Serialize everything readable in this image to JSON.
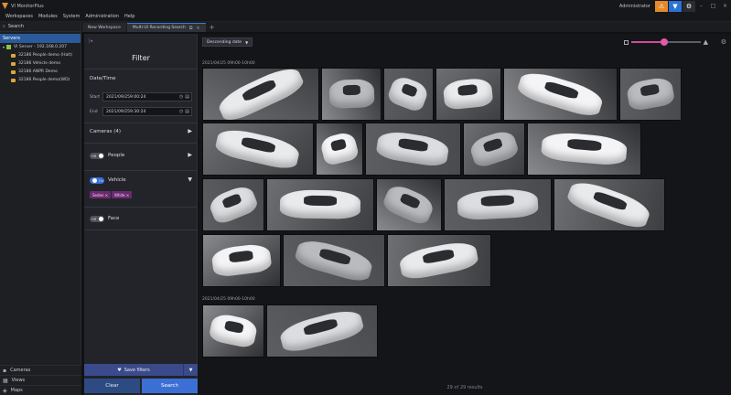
{
  "app": {
    "title": "VI MonitorPlus",
    "user": "Administrator"
  },
  "menu": [
    "Workspaces",
    "Modules",
    "System",
    "Administration",
    "Help"
  ],
  "sidebar": {
    "search_label": "Search",
    "section_label": "Servers",
    "tree": [
      {
        "label": "VI Server - 192.168.0.207",
        "kind": "server"
      },
      {
        "label": "32186 People demo (Halt)",
        "kind": "camera"
      },
      {
        "label": "32186 Vehicle demo",
        "kind": "camera"
      },
      {
        "label": "32186 ANPR Demo",
        "kind": "camera"
      },
      {
        "label": "32186 People demo(WD)",
        "kind": "camera"
      }
    ],
    "bottom": [
      {
        "label": "Cameras",
        "icon": "camera-icon"
      },
      {
        "label": "Views",
        "icon": "grid-icon"
      },
      {
        "label": "Maps",
        "icon": "map-icon"
      }
    ]
  },
  "tabs": [
    {
      "label": "New Workspace",
      "active": false
    },
    {
      "label": "Multi-Ul Recording Search",
      "active": true
    }
  ],
  "filter": {
    "title": "Filter",
    "datetime_label": "Date/Time",
    "start_label": "Start",
    "start_date": "2021/09/25",
    "start_time": "9:00:24",
    "end_label": "End",
    "end_date": "2021/09/25",
    "end_time": "9:30:24",
    "cameras_label": "Cameras (4)",
    "people_label": "People",
    "people_toggle": "Off",
    "vehicle_label": "Vehicle",
    "vehicle_toggle": "On",
    "vehicle_chips": [
      "Sedan ×",
      "White ×"
    ],
    "face_label": "Face",
    "face_toggle": "Off",
    "save_filters_label": "Save filters",
    "clear_label": "Clear",
    "search_label": "Search"
  },
  "results": {
    "sort_label": "Descending date",
    "group1_label": "2021/04/25 09h00-10h00",
    "group2_label": "2021/04/25 09h00-10h00",
    "count_text": "29 of 29 results",
    "zoom_level": 0.47
  }
}
